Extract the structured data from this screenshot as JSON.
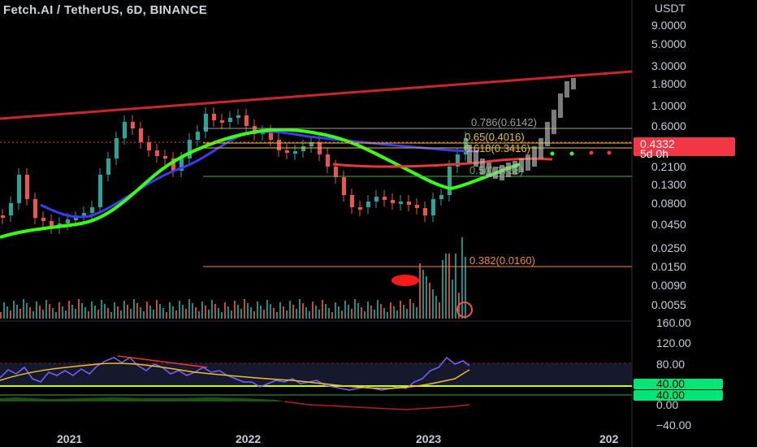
{
  "header": {
    "title": "Fetch.AI / TetherUS, 6D, BINANCE"
  },
  "price_axis": {
    "currency": "USDT",
    "ticks": [
      "9.0000",
      "5.0000",
      "3.0000",
      "1.8000",
      "1.0000",
      "0.6000",
      "0.2100",
      "0.1300",
      "0.0800",
      "0.0450",
      "0.0250",
      "0.0150",
      "0.0090",
      "0.0055"
    ]
  },
  "price_badge": {
    "value": "0.4332",
    "countdown": "5d 0h"
  },
  "fib_levels": [
    {
      "label": "0.786(0.6142)"
    },
    {
      "label": "0.65(0.4016)"
    },
    {
      "label": "0.618(0.3416)"
    },
    {
      "label": "0.5(0.1738)"
    },
    {
      "label": "0.382(0.0160)"
    }
  ],
  "oscillator_axis": {
    "ticks": [
      "160.00",
      "120.00",
      "80.00",
      "0.00",
      "−40.00"
    ],
    "badges": [
      "40.00",
      "40.00"
    ]
  },
  "time_axis": {
    "labels": [
      "2021",
      "2022",
      "2023",
      "202"
    ]
  },
  "colors": {
    "background": "#000000",
    "up": "#26a69a",
    "down": "#ef5350",
    "trendline": "#d32f2f",
    "ma_green": "#39ff14",
    "ma_blue": "#3b3bf5",
    "fib_gray": "#9e9e9e",
    "fib_yellow": "#e6c229",
    "fib_green": "#4caf50",
    "fib_orange": "#ef8a3c",
    "badge_red": "#f23645",
    "badge_green": "#00e676"
  }
}
